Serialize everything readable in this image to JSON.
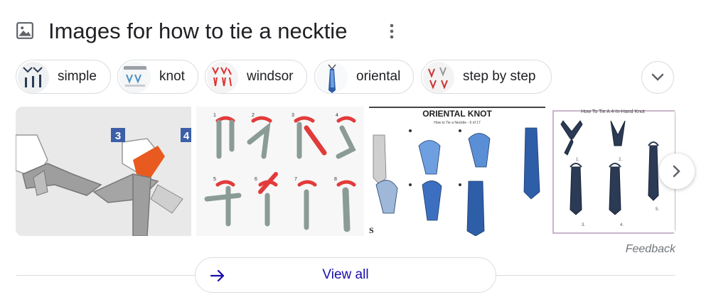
{
  "header": {
    "title": "Images for how to tie a necktie",
    "icon": "image-icon",
    "more_icon": "more-vert-icon"
  },
  "chips": [
    {
      "label": "simple"
    },
    {
      "label": "knot"
    },
    {
      "label": "windsor"
    },
    {
      "label": "oriental"
    },
    {
      "label": "step by step"
    }
  ],
  "expand_icon": "chevron-down-icon",
  "images": [
    {
      "overlay_numbers": [
        "3",
        "4"
      ]
    },
    {
      "step_numbers": [
        "1",
        "2",
        "3",
        "4",
        "5",
        "6",
        "7",
        "8"
      ]
    },
    {
      "title": "ORIENTAL KNOT",
      "subtitle": "How to Tie a Necktie - 6 of 17",
      "corner": "S"
    },
    {
      "title": "How To Tie A 4-In-Hand Knot",
      "step_numbers": [
        "1.",
        "2.",
        "3.",
        "4.",
        "5."
      ]
    }
  ],
  "next_icon": "chevron-right-icon",
  "feedback_label": "Feedback",
  "view_all": {
    "label": "View all",
    "icon": "arrow-right-icon"
  },
  "colors": {
    "link": "#1a0dab",
    "text": "#202124",
    "muted": "#70757a",
    "border": "#dadce0",
    "accent_blue": "#3c5fa8",
    "tie_red": "#e03a3a"
  }
}
